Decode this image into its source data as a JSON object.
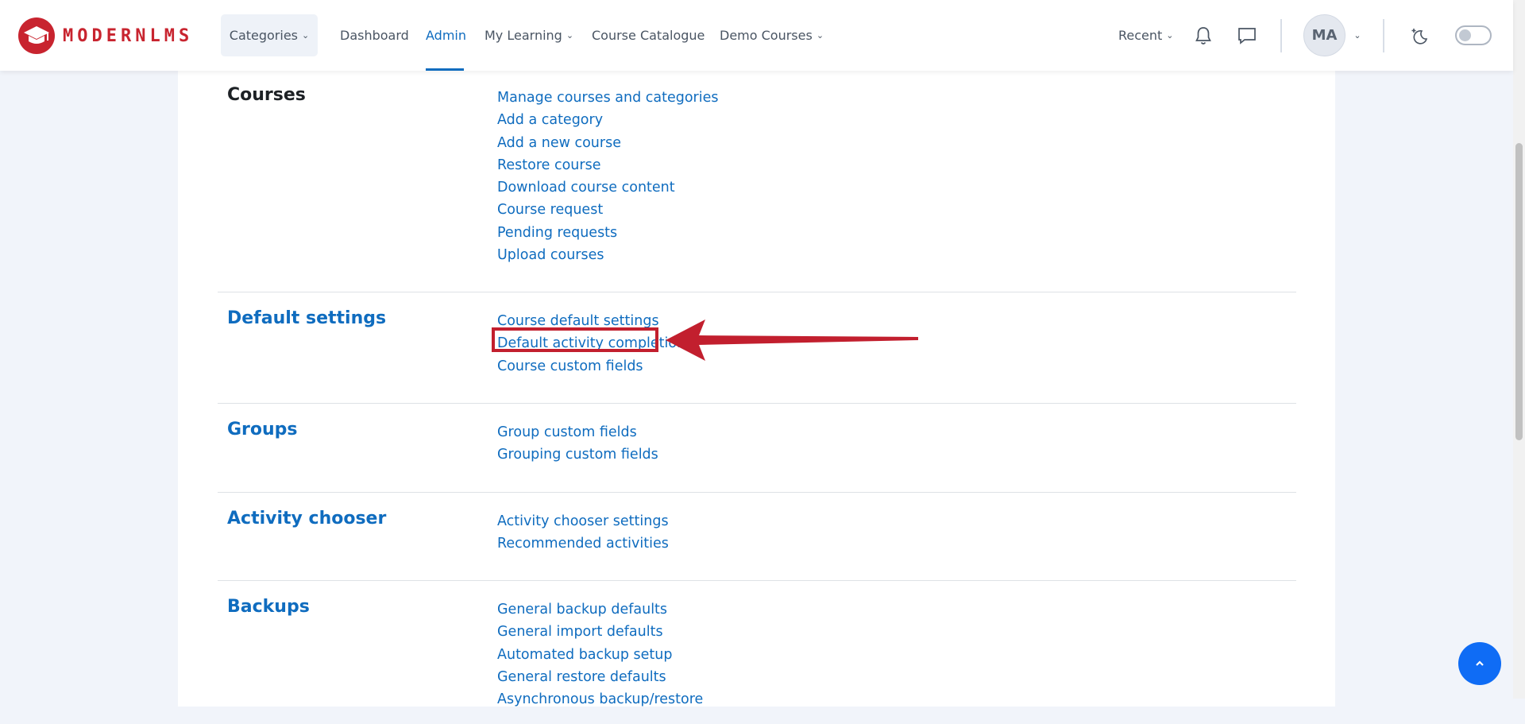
{
  "brand": {
    "name": "MODERNLMS"
  },
  "navbar": {
    "categories_label": "Categories",
    "items": [
      {
        "label": "Dashboard"
      },
      {
        "label": "Admin",
        "active": true
      },
      {
        "label": "My Learning"
      },
      {
        "label": "Course Catalogue"
      },
      {
        "label": "Demo Courses"
      }
    ],
    "recent_label": "Recent",
    "avatar_initials": "MA",
    "icons": [
      "bell-icon",
      "chat-icon",
      "dark-mode-icon",
      "chevron-down-icon"
    ]
  },
  "sections": [
    {
      "title": "Courses",
      "links": [
        "Manage courses and categories",
        "Add a category",
        "Add a new course",
        "Restore course",
        "Download course content",
        "Course request",
        "Pending requests",
        "Upload courses"
      ]
    },
    {
      "title": "Default settings",
      "links": [
        "Course default settings",
        "Default activity completion",
        "Course custom fields"
      ]
    },
    {
      "title": "Groups",
      "links": [
        "Group custom fields",
        "Grouping custom fields"
      ]
    },
    {
      "title": "Activity chooser",
      "links": [
        "Activity chooser settings",
        "Recommended activities"
      ]
    },
    {
      "title": "Backups",
      "links": [
        "General backup defaults",
        "General import defaults",
        "Automated backup setup",
        "General restore defaults",
        "Asynchronous backup/restore"
      ]
    }
  ],
  "annotation": {
    "highlighted_link": "Default activity completion",
    "color": "#c21f2e"
  },
  "colors": {
    "link": "#0f6cbf",
    "background": "#f1f4fa",
    "accent_button": "#0f6cf5"
  }
}
